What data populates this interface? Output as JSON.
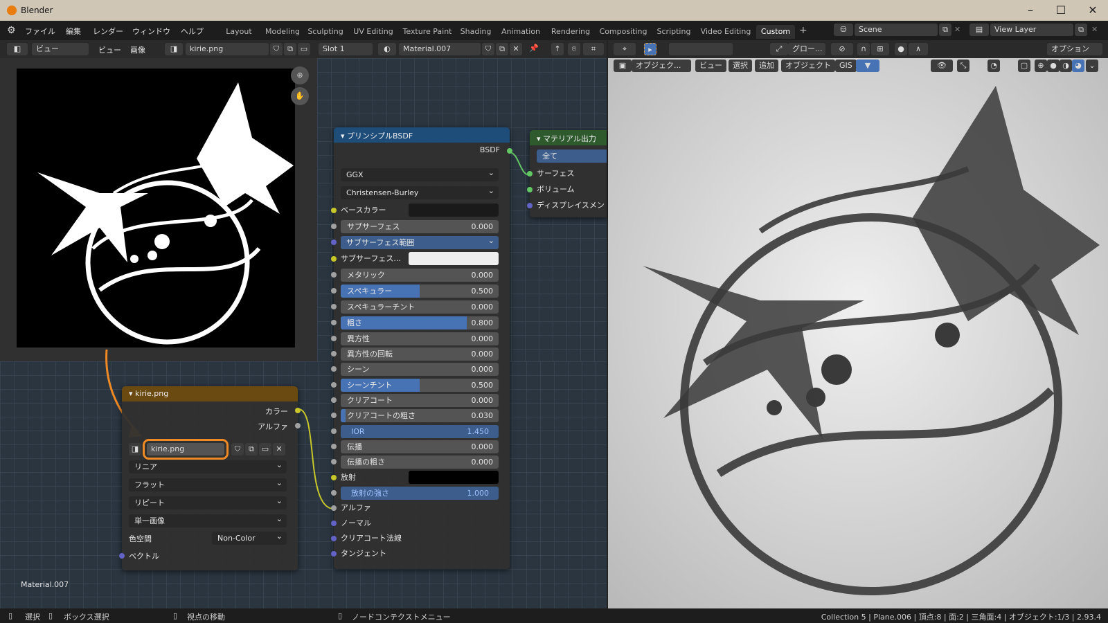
{
  "app": {
    "title": "Blender"
  },
  "menu": [
    "ファイル",
    "編集",
    "レンダー",
    "ウィンドウ",
    "ヘルプ"
  ],
  "workspaces": [
    "Layout",
    "Modeling",
    "Sculpting",
    "UV Editing",
    "Texture Paint",
    "Shading",
    "Animation",
    "Rendering",
    "Compositing",
    "Scripting",
    "Video Editing",
    "Custom"
  ],
  "active_workspace": "Custom",
  "scene": {
    "name": "Scene",
    "view_layer": "View Layer"
  },
  "image_editor": {
    "view": "ビュー",
    "view2": "ビュー",
    "image": "画像",
    "image_name": "kirie.png"
  },
  "node_header": {
    "slot": "Slot 1",
    "material": "Material.007"
  },
  "viewport_header": {
    "transform": "グロー...",
    "options": "オプション",
    "mode": "オブジェク...",
    "view": "ビュー",
    "select": "選択",
    "add": "追加",
    "object": "オブジェクト",
    "gis": "GIS"
  },
  "image_node": {
    "title": "kirie.png",
    "out_color": "カラー",
    "out_alpha": "アルファ",
    "image": "kirie.png",
    "interp": "リニア",
    "proj": "フラット",
    "ext": "リピート",
    "source": "単一画像",
    "cs_label": "色空間",
    "colorspace": "Non-Color",
    "in_vector": "ベクトル"
  },
  "bsdf": {
    "title": "プリンシプルBSDF",
    "out": "BSDF",
    "dist": "GGX",
    "sss_method": "Christensen-Burley",
    "base_color": "ベースカラー",
    "subsurface": {
      "label": "サブサーフェス",
      "value": "0.000"
    },
    "sss_radius": "サブサーフェス範囲",
    "sss_color": "サブサーフェス...",
    "metallic": {
      "label": "メタリック",
      "value": "0.000"
    },
    "specular": {
      "label": "スペキュラー",
      "value": "0.500",
      "fill": 0.5
    },
    "spec_tint": {
      "label": "スペキュラーチント",
      "value": "0.000"
    },
    "roughness": {
      "label": "粗さ",
      "value": "0.800",
      "fill": 0.8
    },
    "aniso": {
      "label": "異方性",
      "value": "0.000"
    },
    "aniso_rot": {
      "label": "異方性の回転",
      "value": "0.000"
    },
    "sheen": {
      "label": "シーン",
      "value": "0.000"
    },
    "sheen_tint": {
      "label": "シーンチント",
      "value": "0.500",
      "fill": 0.5
    },
    "clearcoat": {
      "label": "クリアコート",
      "value": "0.000"
    },
    "cc_rough": {
      "label": "クリアコートの粗さ",
      "value": "0.030",
      "fill": 0.03
    },
    "ior": {
      "label": "IOR",
      "value": "1.450"
    },
    "transmission": {
      "label": "伝播",
      "value": "0.000"
    },
    "trans_rough": {
      "label": "伝播の粗さ",
      "value": "0.000"
    },
    "emission": "放射",
    "emission_strength": {
      "label": "放射の強さ",
      "value": "1.000"
    },
    "alpha": "アルファ",
    "normal": "ノーマル",
    "cc_normal": "クリアコート法線",
    "tangent": "タンジェント"
  },
  "output_node": {
    "title": "マテリアル出力",
    "target": "全て",
    "surface": "サーフェス",
    "volume": "ボリューム",
    "displacement": "ディスプレイスメン"
  },
  "material_label": "Material.007",
  "status": {
    "select": "選択",
    "box": "ボックス選択",
    "rotate": "視点の移動",
    "ctx": "ノードコンテクストメニュー",
    "info": "Collection 5 | Plane.006 | 頂点:8 | 面:2 | 三角面:4 | オブジェクト:1/3 | 2.93.4"
  },
  "colors": {
    "accent": "#4772b3",
    "highlight": "#f08a24",
    "bsdf_header": "#1e4d7a",
    "image_header": "#6b4a12",
    "output_header": "#2e5a2e"
  }
}
